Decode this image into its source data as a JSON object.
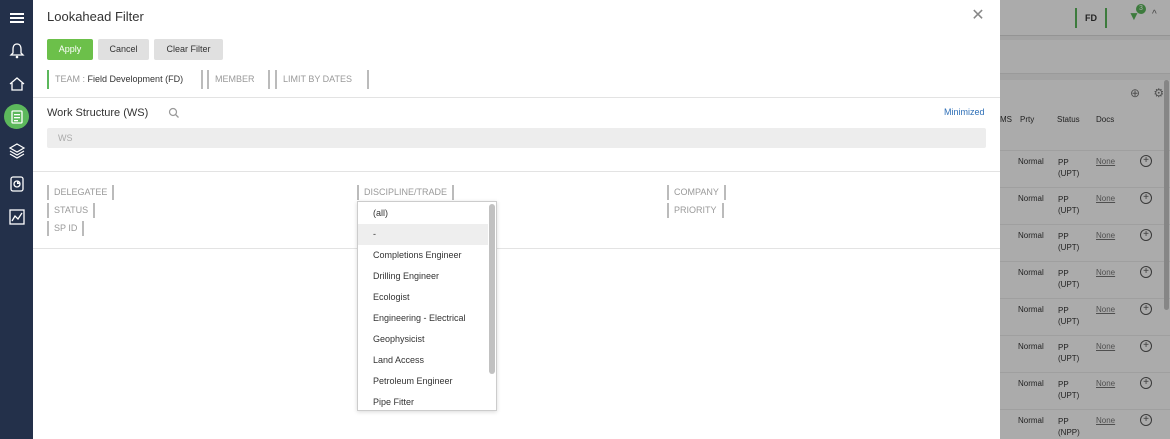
{
  "background_app": {
    "team_badge": "FD",
    "filter_count": "3",
    "columns": [
      "MS",
      "Prty",
      "Status",
      "Docs"
    ],
    "rows": [
      {
        "prty": "Normal",
        "status1": "PP",
        "status2": "(UPT)",
        "docs": "None"
      },
      {
        "prty": "Normal",
        "status1": "PP",
        "status2": "(UPT)",
        "docs": "None"
      },
      {
        "prty": "Normal",
        "status1": "PP",
        "status2": "(UPT)",
        "docs": "None"
      },
      {
        "prty": "Normal",
        "status1": "PP",
        "status2": "(UPT)",
        "docs": "None"
      },
      {
        "prty": "Normal",
        "status1": "PP",
        "status2": "(UPT)",
        "docs": "None"
      },
      {
        "prty": "Normal",
        "status1": "PP",
        "status2": "(UPT)",
        "docs": "None"
      },
      {
        "prty": "Normal",
        "status1": "PP",
        "status2": "(UPT)",
        "docs": "None"
      },
      {
        "prty": "Normal",
        "status1": "PP",
        "status2": "(NPP)",
        "docs": "None"
      }
    ]
  },
  "modal": {
    "title": "Lookahead Filter",
    "buttons": {
      "apply": "Apply",
      "cancel": "Cancel",
      "clear": "Clear Filter"
    },
    "chips": {
      "team_label": "TEAM :",
      "team_value": "Field Development (FD)",
      "member": "MEMBER",
      "dates": "LIMIT BY DATES"
    },
    "work_structure": {
      "title": "Work Structure (WS)",
      "minimized": "Minimized",
      "input_placeholder": "WS"
    },
    "filters": {
      "delegatee": "DELEGATEE",
      "status": "STATUS",
      "sp_id": "SP ID",
      "discipline": "DISCIPLINE/TRADE",
      "company": "COMPANY",
      "priority": "PRIORITY"
    },
    "dropdown": {
      "items": [
        "(all)",
        "-",
        "Completions Engineer",
        "Drilling Engineer",
        "Ecologist",
        "Engineering - Electrical",
        "Geophysicist",
        "Land Access",
        "Petroleum Engineer",
        "Pipe Fitter"
      ],
      "highlighted": "-"
    }
  },
  "colors": {
    "accent": "#6cc04a",
    "nav_bg": "#23304a",
    "link": "#2e6fb7"
  }
}
